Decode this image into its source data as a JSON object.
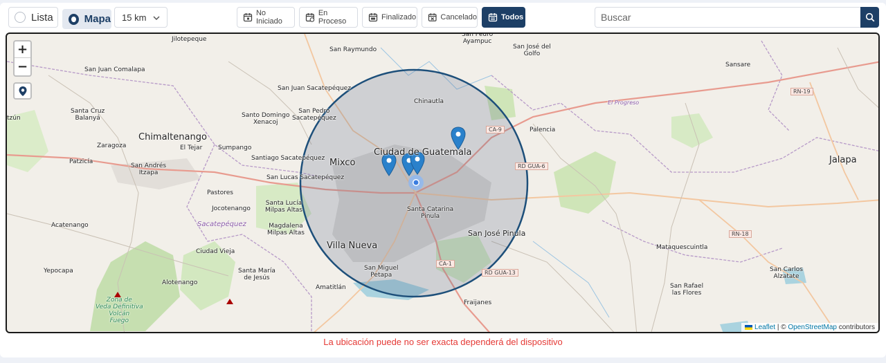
{
  "toolbar": {
    "view_list_label": "Lista",
    "view_map_label": "Mapa",
    "radius_value": "15 km",
    "filters": [
      {
        "label": "No Iniciado",
        "icon": "calendar-icon"
      },
      {
        "label": "En Proceso",
        "icon": "calendar-clock-icon"
      },
      {
        "label": "Finalizado",
        "icon": "calendar-check-icon"
      },
      {
        "label": "Cancelado",
        "icon": "calendar-x-icon"
      },
      {
        "label": "Todos",
        "icon": "calendar-list-icon"
      }
    ],
    "search_placeholder": "Buscar"
  },
  "map": {
    "zoom_in": "+",
    "zoom_out": "−",
    "labels": {
      "ciudad_guatemala": "Ciudad de Guatemala",
      "mixco": "Mixco",
      "villa_nueva": "Villa Nueva",
      "chimaltenango": "Chimaltenango",
      "jalapa": "Jalapa",
      "san_jose_pinula": "San José Pinula",
      "santa_catarina": "Santa Catarina\nPinula",
      "chinautla": "Chinautla",
      "palencia": "Palencia",
      "san_raymundo": "San Raymundo",
      "san_pedro_ayampuc": "San Pedro\nAyampuc",
      "san_jose_golfo": "San José del\nGolfo",
      "san_juan_comalapa": "San Juan Comalapa",
      "san_juan_sacatepequez": "San Juan Sacatepéquez",
      "santo_domingo": "Santo Domingo\nXenacoj",
      "san_pedro_sacatepequez": "San Pedro\nSacatepéquez",
      "santiago_sacatepequez": "Santiago Sacatepéquez",
      "san_lucas": "San Lucas Sacatepéquez",
      "santa_cruz_balanya": "Santa Cruz\nBalanyá",
      "zaragoza": "Zaragoza",
      "el_tejar": "El Tejar",
      "sumpango": "Sumpango",
      "patzicia": "Patzicía",
      "san_andres_itzapa": "San Andrés\nItzapa",
      "pastores": "Pastores",
      "jocotenango": "Jocotenango",
      "santa_lucia": "Santa Lucía\nMilpas Altas",
      "magdalena": "Magdalena\nMilpas Altas",
      "acatenango": "Acatenango",
      "ciudad_vieja": "Ciudad Vieja",
      "yepocapa": "Yepocapa",
      "alotenango": "Alotenango",
      "santa_maria": "Santa María\nde Jesús",
      "amatitlan": "Amatitlán",
      "san_miguel_petapa": "San Miguel\nPetapa",
      "fraijanes": "Fraijanes",
      "mataquescuintla": "Mataquescuintla",
      "sansare": "Sansare",
      "san_carlos_alzatate": "San Carlos\nAlzatate",
      "san_rafael": "San Rafael\nlas Flores",
      "jilotepeque": "Jilotepeque",
      "tzun": "tzún",
      "sacatepequez_dept": "Sacatepéquez",
      "el_progreso": "El Progreso",
      "zona_veda": "Zona de\nVeda Definitiva\nVolcán\nFuego"
    },
    "shields": [
      "CA-9",
      "RD GUA-6",
      "CA-1",
      "RD GUA-13",
      "RN-19",
      "RN-18"
    ],
    "attribution_leaflet": "Leaflet",
    "attribution_sep": " | © ",
    "attribution_osm": "OpenStreetMap",
    "attribution_contrib": " contributors"
  },
  "footer_note": "La ubicación puede no ser exacta dependerá del dispositivo"
}
